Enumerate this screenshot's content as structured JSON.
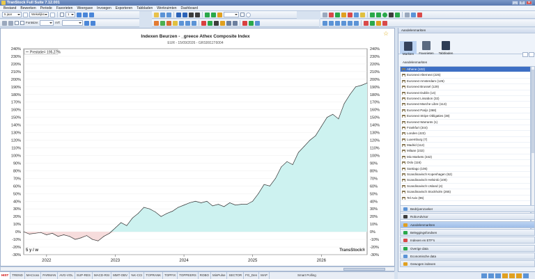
{
  "app": {
    "title": "TranStock Full Suite 7.12.001"
  },
  "menu": [
    "Bestand",
    "Bewerken",
    "Periode",
    "Favorieten",
    "Weergave",
    "Invoegen",
    "Exporteren",
    "Tabbladen",
    "Werkruimten",
    "Dashboard"
  ],
  "toolbar": {
    "period_select": "5 jaar",
    "interval_select": "Wekelijks",
    "page_field": "1",
    "fontsize_label": "Fontsize:",
    "text_label": "mT:"
  },
  "chart": {
    "title": "Indexen Beurzen - _greece Athex Composite Index",
    "subtitle": "EUR - 15/09/2026 - GRS9911T6004",
    "legend": "Prestatie= 195,27%",
    "period_label": "5 y / w",
    "watermark": "TransStock®",
    "x_labels": [
      "2022",
      "2023",
      "2024",
      "2025",
      "2026"
    ],
    "y_labels": [
      "240%",
      "230%",
      "220%",
      "210%",
      "200%",
      "190%",
      "180%",
      "170%",
      "160%",
      "150%",
      "140%",
      "130%",
      "120%",
      "110%",
      "100%",
      "90%",
      "80%",
      "70%",
      "60%",
      "50%",
      "40%",
      "30%",
      "20%",
      "10%",
      "0%",
      "-10%",
      "-20%",
      "-30%"
    ],
    "positive_color": "#cdf2f0",
    "negative_color": "#f6dcdc"
  },
  "chart_data": {
    "type": "area",
    "title": "Indexen Beurzen - _greece Athex Composite Index",
    "subtitle": "EUR - 15/09/2026 - GRS9911T6004",
    "ylim": [
      -30,
      240
    ],
    "x_range": [
      "2021-09",
      "2026-09"
    ],
    "x_ticks": [
      "2022",
      "2023",
      "2024",
      "2025",
      "2026"
    ],
    "series": [
      {
        "name": "Prestatie",
        "x": [
          "2021-09",
          "2021-10",
          "2021-11",
          "2021-12",
          "2022-01",
          "2022-02",
          "2022-03",
          "2022-04",
          "2022-05",
          "2022-06",
          "2022-07",
          "2022-08",
          "2022-09",
          "2022-10",
          "2022-11",
          "2022-12",
          "2023-01",
          "2023-02",
          "2023-03",
          "2023-04",
          "2023-05",
          "2023-06",
          "2023-07",
          "2023-08",
          "2023-09",
          "2023-10",
          "2023-11",
          "2023-12",
          "2024-01",
          "2024-02",
          "2024-03",
          "2024-04",
          "2024-05",
          "2024-06",
          "2024-07",
          "2024-08",
          "2024-09",
          "2024-10",
          "2024-11",
          "2024-12",
          "2025-01",
          "2025-02",
          "2025-03",
          "2025-04",
          "2025-05",
          "2025-06",
          "2025-07",
          "2025-08",
          "2025-09",
          "2025-10",
          "2025-11",
          "2025-12",
          "2026-01",
          "2026-02",
          "2026-03",
          "2026-04",
          "2026-05",
          "2026-06",
          "2026-07",
          "2026-08",
          "2026-09"
        ],
        "values": [
          0,
          -3,
          -2,
          -1,
          -4,
          -2,
          -6,
          -4,
          -6,
          -10,
          -8,
          -5,
          -10,
          -12,
          -6,
          -2,
          5,
          12,
          8,
          18,
          24,
          32,
          30,
          26,
          20,
          24,
          27,
          32,
          35,
          38,
          40,
          38,
          40,
          34,
          36,
          33,
          38,
          35,
          36,
          36,
          40,
          50,
          62,
          60,
          70,
          85,
          92,
          88,
          104,
          112,
          120,
          126,
          138,
          150,
          154,
          148,
          168,
          180,
          190,
          192,
          195
        ]
      }
    ]
  },
  "side": {
    "header": "Aandelenmarkten",
    "tabs": [
      "Markten",
      "Favorieten",
      "Tabbladen"
    ],
    "list_header": "Aandelenmarkten",
    "markets": [
      "Athene (102)",
      "Euronext Alternext (225)",
      "Euronext Amsterdam (126)",
      "Euronext Brussel (129)",
      "Euronext Dublin (14)",
      "Euronext Lissabon (32)",
      "Euronext Marche Libre (113)",
      "Euronext Parijs (368)",
      "Euronext Stripe Obligaties (38)",
      "Euronext Warrants (1)",
      "Frankfurt (344)",
      "Londen (422)",
      "Luxemburg (7)",
      "Madrid (112)",
      "Milaan (232)",
      "Mix Markets (342)",
      "Oslo (116)",
      "Santiago (106)",
      "Scandinavisch Kopenhagen (52)",
      "Scandinavisch Helsinki (100)",
      "Scandinavisch IJsland (4)",
      "Scandinavisch Stockholm (265)",
      "Tel Aviv (96)"
    ],
    "nav": [
      "Bedrijvenzoeker",
      "RoboAdvisor",
      "Aandelenmarkten",
      "Beleggingsfondsen",
      "Indexen en ETF's",
      "Overige data",
      "Economische data",
      "Gewogen indexen"
    ]
  },
  "bottom_tabs": [
    "HIST",
    "TREND",
    "MACross",
    "PARMAN",
    "AVG-VOL",
    "SUP-RES",
    "MACD-RSI",
    "MMT-OBV",
    "%K-CCI",
    "TOPRANK",
    "TOPFIX",
    "TOPPEERS",
    "ROBO",
    "MinPulse",
    "SECTOR",
    "FG_Den",
    "MAP",
    "Smart Polling"
  ]
}
